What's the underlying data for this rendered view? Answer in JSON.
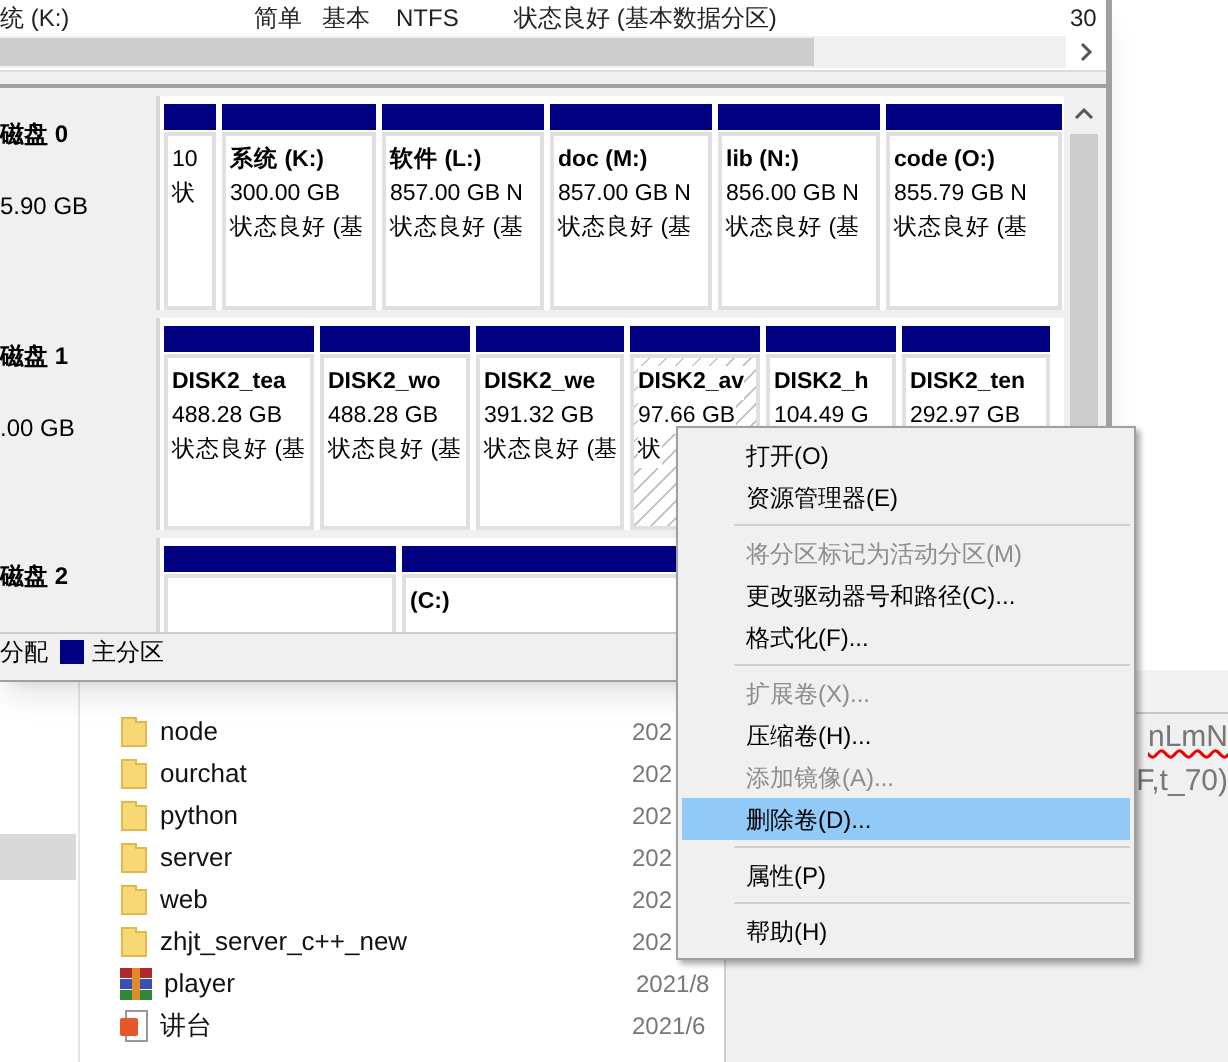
{
  "volume_list_row": [
    "统 (K:)",
    "简单",
    "基本",
    "NTFS",
    "状态良好 (基本数据分区)",
    "30"
  ],
  "disks": [
    {
      "name": "磁盘 0",
      "size": "5.90 GB",
      "partitions": [
        {
          "kind": "primary",
          "selected": false,
          "details": [
            "10",
            "状"
          ]
        },
        {
          "kind": "primary",
          "selected": false,
          "label": "系统  (K:)",
          "details": [
            "300.00 GB",
            "状态良好 (基"
          ]
        },
        {
          "kind": "primary",
          "selected": false,
          "label": "软件  (L:)",
          "details": [
            "857.00 GB N",
            "状态良好 (基"
          ]
        },
        {
          "kind": "primary",
          "selected": false,
          "label": "doc  (M:)",
          "details": [
            "857.00 GB N",
            "状态良好 (基"
          ]
        },
        {
          "kind": "primary",
          "selected": false,
          "label": "lib  (N:)",
          "details": [
            "856.00 GB N",
            "状态良好 (基"
          ]
        },
        {
          "kind": "primary",
          "selected": false,
          "label": "code  (O:)",
          "details": [
            "855.79 GB N",
            "状态良好 (基"
          ]
        }
      ]
    },
    {
      "name": "磁盘 1",
      "size": ".00 GB",
      "partitions": [
        {
          "kind": "primary",
          "selected": false,
          "label": "DISK2_tea",
          "details": [
            "488.28 GB",
            "状态良好 (基"
          ]
        },
        {
          "kind": "primary",
          "selected": false,
          "label": "DISK2_wo",
          "details": [
            "488.28 GB",
            "状态良好 (基"
          ]
        },
        {
          "kind": "primary",
          "selected": false,
          "label": "DISK2_we",
          "details": [
            "391.32 GB",
            "状态良好 (基"
          ]
        },
        {
          "kind": "primary",
          "selected": true,
          "label": "DISK2_av",
          "details": [
            "97.66 GB",
            "状"
          ]
        },
        {
          "kind": "primary",
          "selected": false,
          "label": "DISK2_h",
          "details": [
            "104.49 G"
          ]
        },
        {
          "kind": "primary",
          "selected": false,
          "label": "DISK2_ten",
          "details": [
            "292.97 GB"
          ]
        }
      ]
    },
    {
      "name": "磁盘 2",
      "partitions": [
        {
          "kind": "primary",
          "selected": false
        },
        {
          "kind": "primary",
          "selected": false,
          "label": "(C:)"
        }
      ]
    }
  ],
  "legend": [
    {
      "label": "分配"
    },
    {
      "label": "主分区",
      "color": "#000080"
    }
  ],
  "files": [
    {
      "kind": "folder",
      "name": "node",
      "date": "202"
    },
    {
      "kind": "folder",
      "name": "ourchat",
      "date": "202"
    },
    {
      "kind": "folder",
      "name": "python",
      "date": "202"
    },
    {
      "kind": "folder",
      "name": "server",
      "date": "202"
    },
    {
      "kind": "folder",
      "name": "web",
      "date": "202"
    },
    {
      "kind": "folder",
      "name": "zhjt_server_c++_new",
      "date": "202"
    },
    {
      "kind": "archive",
      "name": "player",
      "date": "2021/8"
    },
    {
      "kind": "slides",
      "name": "讲台",
      "date": "2021/6"
    }
  ],
  "editor_lines": [
    "nLmN",
    "F,t_70)"
  ],
  "context_menu": [
    {
      "kind": "item",
      "label": "打开(O)",
      "disabled": false,
      "selected": false
    },
    {
      "kind": "item",
      "label": "资源管理器(E)",
      "disabled": false,
      "selected": false
    },
    {
      "kind": "separator"
    },
    {
      "kind": "item",
      "label": "将分区标记为活动分区(M)",
      "disabled": true,
      "selected": false
    },
    {
      "kind": "item",
      "label": "更改驱动器号和路径(C)...",
      "disabled": false,
      "selected": false
    },
    {
      "kind": "item",
      "label": "格式化(F)...",
      "disabled": false,
      "selected": false
    },
    {
      "kind": "separator"
    },
    {
      "kind": "item",
      "label": "扩展卷(X)...",
      "disabled": true,
      "selected": false
    },
    {
      "kind": "item",
      "label": "压缩卷(H)...",
      "disabled": false,
      "selected": false
    },
    {
      "kind": "item",
      "label": "添加镜像(A)...",
      "disabled": true,
      "selected": false
    },
    {
      "kind": "item",
      "label": "删除卷(D)...",
      "disabled": false,
      "selected": true
    },
    {
      "kind": "separator"
    },
    {
      "kind": "item",
      "label": "属性(P)",
      "disabled": false,
      "selected": false
    },
    {
      "kind": "separator"
    },
    {
      "kind": "item",
      "label": "帮助(H)",
      "disabled": false,
      "selected": false
    }
  ]
}
